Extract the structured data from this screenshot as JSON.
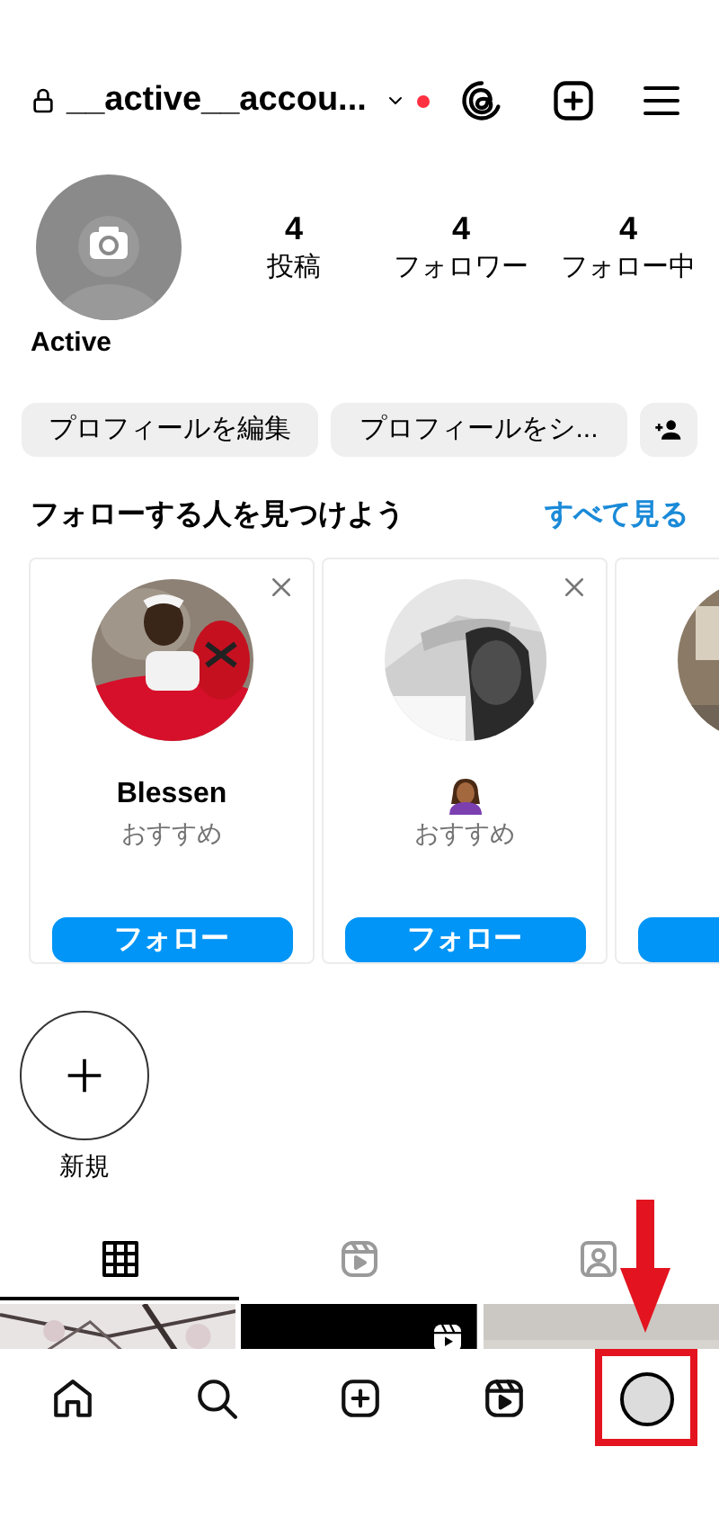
{
  "top_bar": {
    "username": "__active__accou...",
    "has_notification": true
  },
  "profile": {
    "display_name": "Active",
    "stats": [
      {
        "value": "4",
        "label": "投稿"
      },
      {
        "value": "4",
        "label": "フォロワー"
      },
      {
        "value": "4",
        "label": "フォロー中"
      }
    ]
  },
  "action_buttons": [
    {
      "kind": "text",
      "label": "プロフィールを編集"
    },
    {
      "kind": "text",
      "label": "プロフィールをシ..."
    },
    {
      "kind": "add_person"
    }
  ],
  "suggestions": {
    "title": "フォローする人を見つけよう",
    "see_all": "すべて見る",
    "cards": [
      {
        "kind": "named",
        "name": "Blessen",
        "subtitle": "おすすめ",
        "button": "フォロー",
        "dismissible": true
      },
      {
        "kind": "emoji",
        "subtitle": "おすすめ",
        "button": "フォロー",
        "dismissible": true
      },
      {
        "kind": "cut"
      }
    ]
  },
  "highlights": [
    {
      "kind": "new",
      "label": "新規"
    }
  ],
  "tabs": [
    {
      "kind": "grid",
      "selected": true
    },
    {
      "kind": "reels",
      "selected": false
    },
    {
      "kind": "tagged",
      "selected": false
    }
  ],
  "posts": [
    {
      "kind": "picture",
      "reel": false
    },
    {
      "kind": "picture",
      "reel": true
    },
    {
      "kind": "picture",
      "reel": false
    }
  ],
  "bottom_nav": [
    {
      "kind": "home",
      "selected": false,
      "annotated": false
    },
    {
      "kind": "search",
      "selected": false,
      "annotated": false
    },
    {
      "kind": "create",
      "selected": false,
      "annotated": false
    },
    {
      "kind": "reels",
      "selected": false,
      "annotated": false
    },
    {
      "kind": "profile",
      "selected": true,
      "annotated": true
    }
  ]
}
